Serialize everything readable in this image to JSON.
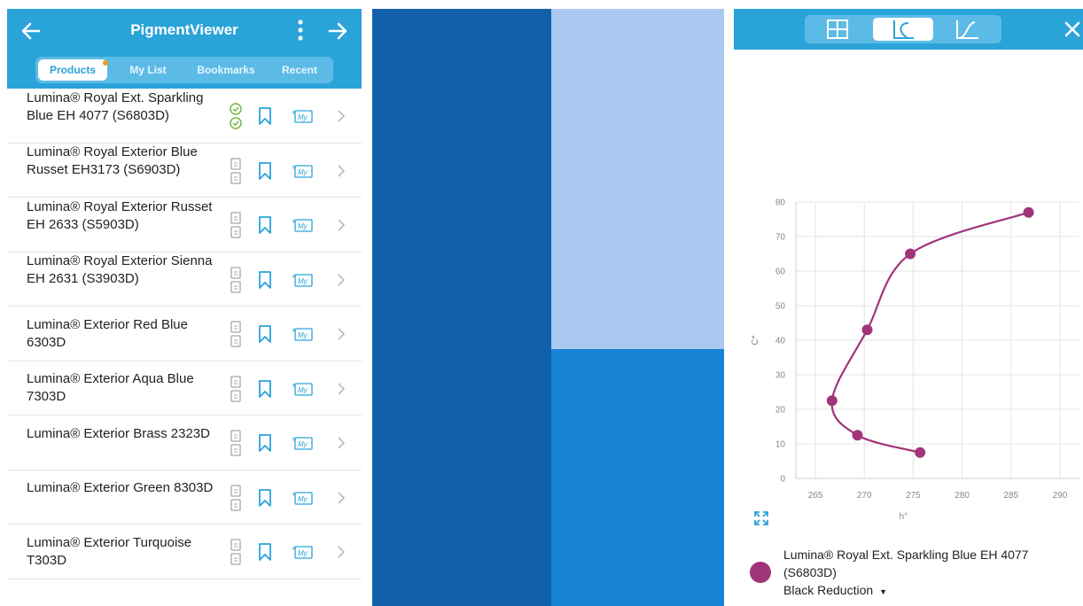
{
  "app": {
    "title": "PigmentViewer"
  },
  "tabs": [
    {
      "label": "Products",
      "active": true,
      "dot": true
    },
    {
      "label": "My List",
      "active": false,
      "dot": false
    },
    {
      "label": "Bookmarks",
      "active": false,
      "dot": false
    },
    {
      "label": "Recent",
      "active": false,
      "dot": false
    }
  ],
  "products": [
    {
      "name": "Lumina® Royal Ext. Sparkling Blue EH 4077 (S6803D)",
      "checked": true
    },
    {
      "name": "Lumina® Royal Exterior Blue Russet EH3173 (S6903D)",
      "checked": false
    },
    {
      "name": "Lumina® Royal Exterior Russet EH 2633 (S5903D)",
      "checked": false
    },
    {
      "name": "Lumina® Royal Exterior Sienna EH 2631 (S3903D)",
      "checked": false
    },
    {
      "name": "Lumina® Exterior Red Blue 6303D",
      "checked": false
    },
    {
      "name": "Lumina® Exterior Aqua Blue 7303D",
      "checked": false
    },
    {
      "name": "Lumina® Exterior Brass 2323D",
      "checked": false
    },
    {
      "name": "Lumina® Exterior Green 8303D",
      "checked": false
    },
    {
      "name": "Lumina® Exterior Turquoise T303D",
      "checked": false
    }
  ],
  "icons": {
    "my_label": "My"
  },
  "colors": {
    "header": "#2aa3d9",
    "swatch_dark": "#1260aa",
    "swatch_light": "#a9c9f1",
    "swatch_mid": "#1784d6",
    "series": "#a0357a"
  },
  "chart_data": {
    "type": "line",
    "xlabel": "h°",
    "ylabel": "C*",
    "xlim": [
      263,
      292
    ],
    "ylim": [
      0,
      80
    ],
    "xticks": [
      265,
      270,
      275,
      280,
      285,
      290
    ],
    "yticks": [
      0,
      10,
      20,
      30,
      40,
      50,
      60,
      70,
      80
    ],
    "grid": true,
    "series": [
      {
        "name": "Lumina® Royal Ext. Sparkling Blue EH 4077 (S6803D)",
        "points": [
          {
            "x": 275.7,
            "y": 7.5
          },
          {
            "x": 269.3,
            "y": 12.5
          },
          {
            "x": 266.7,
            "y": 22.5
          },
          {
            "x": 270.3,
            "y": 43.0
          },
          {
            "x": 274.7,
            "y": 65.0
          },
          {
            "x": 286.8,
            "y": 77.0
          }
        ]
      }
    ]
  },
  "legend": {
    "name": "Lumina® Royal Ext. Sparkling Blue EH 4077 (S6803D)",
    "sub": "Black Reduction"
  }
}
